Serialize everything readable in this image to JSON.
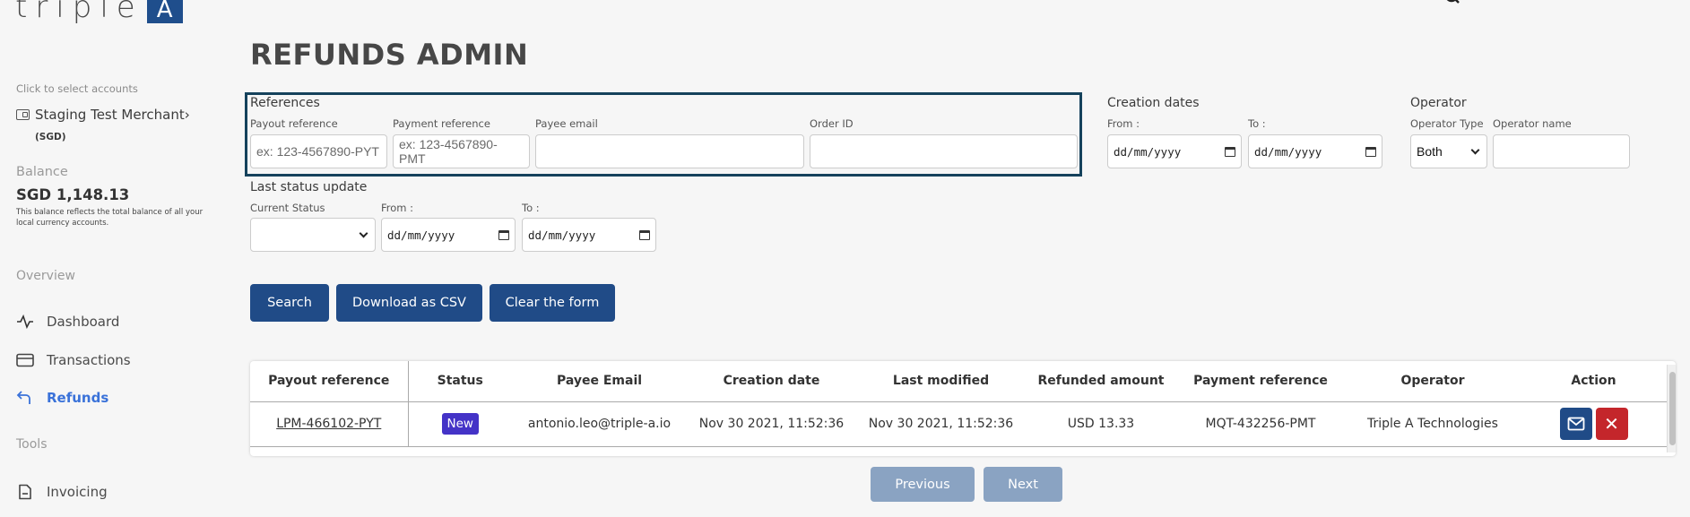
{
  "brand": {
    "logo_text": "triple",
    "logo_mark": "A"
  },
  "sidebar": {
    "select_hint": "Click to select accounts",
    "merchant_name": "Staging Test Merchant",
    "merchant_chevron": "›",
    "currency": "(SGD)",
    "balance_label": "Balance",
    "balance_value": "SGD 1,148.13",
    "balance_note": "This balance reflects the total balance of all your local currency accounts.",
    "sections": [
      {
        "title": "Overview"
      },
      {
        "title": "Tools"
      }
    ],
    "items": [
      {
        "label": "Dashboard",
        "icon": "activity-icon",
        "active": false
      },
      {
        "label": "Transactions",
        "icon": "credit-card-icon",
        "active": false
      },
      {
        "label": "Refunds",
        "icon": "reply-arrow-icon",
        "active": true
      },
      {
        "label": "Invoicing",
        "icon": "document-icon",
        "active": false
      }
    ]
  },
  "page": {
    "title": "REFUNDS ADMIN"
  },
  "filters": {
    "references": {
      "title": "References",
      "payout_reference": {
        "label": "Payout reference",
        "placeholder": "ex: 123-4567890-PYT",
        "value": ""
      },
      "payment_reference": {
        "label": "Payment reference",
        "placeholder": "ex: 123-4567890-PMT",
        "value": ""
      },
      "payee_email": {
        "label": "Payee email",
        "value": ""
      },
      "order_id": {
        "label": "Order ID",
        "value": ""
      }
    },
    "creation_dates": {
      "title": "Creation dates",
      "from_label": "From :",
      "to_label": "To :",
      "from_value": "dd/mm/yyyy",
      "to_value": "dd/mm/yyyy"
    },
    "operator": {
      "title": "Operator",
      "type_label": "Operator Type",
      "type_value": "Both",
      "name_label": "Operator name",
      "name_value": ""
    },
    "last_status": {
      "title": "Last status update",
      "status_label": "Current Status",
      "status_value": "",
      "from_label": "From :",
      "to_label": "To :",
      "from_value": "dd/mm/yyyy",
      "to_value": "dd/mm/yyyy"
    }
  },
  "actions": {
    "search": "Search",
    "download_csv": "Download as CSV",
    "clear_form": "Clear the form"
  },
  "table": {
    "columns": [
      "Payout reference",
      "Status",
      "Payee Email",
      "Creation date",
      "Last modified",
      "Refunded amount",
      "Payment reference",
      "Operator",
      "Action"
    ],
    "rows": [
      {
        "payout_reference": "LPM-466102-PYT",
        "status": "New",
        "payee_email": "antonio.leo@triple-a.io",
        "creation_date": "Nov 30 2021, 11:52:36",
        "last_modified": "Nov 30 2021, 11:52:36",
        "refunded_amount": "USD 13.33",
        "payment_reference": "MQT-432256-PMT",
        "operator": "Triple A Technologies",
        "delete_label": "✕"
      }
    ]
  },
  "pagination": {
    "previous": "Previous",
    "next": "Next"
  },
  "colors": {
    "primary": "#204b87",
    "disabled": "#8aa3c2",
    "status_new": "#4433c7",
    "danger": "#c4262b",
    "active_nav": "#3a72d9",
    "highlight_border": "#15425c"
  }
}
